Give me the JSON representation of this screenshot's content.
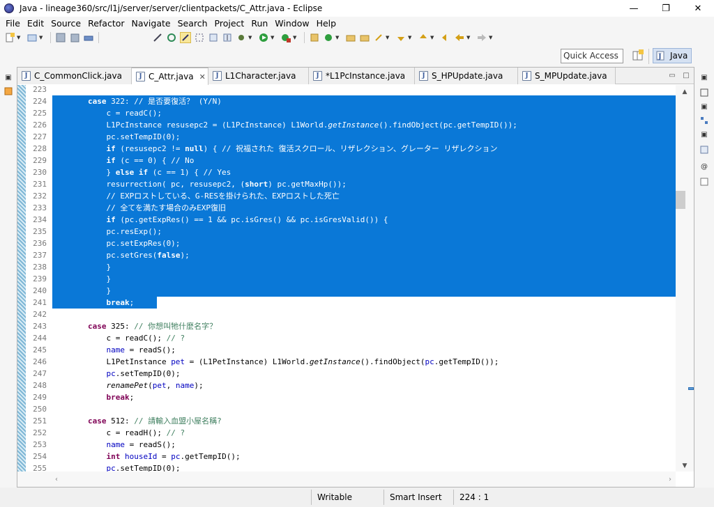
{
  "window": {
    "title": "Java - lineage360/src/l1j/server/server/clientpackets/C_Attr.java - Eclipse",
    "minimize": "—",
    "maximize": "❐",
    "close": "✕"
  },
  "menu": [
    "File",
    "Edit",
    "Source",
    "Refactor",
    "Navigate",
    "Search",
    "Project",
    "Run",
    "Window",
    "Help"
  ],
  "quick_access": {
    "placeholder": "Quick Access"
  },
  "perspective": {
    "label": "Java"
  },
  "tabs": [
    {
      "label": "C_CommonClick.java",
      "active": false
    },
    {
      "label": "C_Attr.java",
      "active": true,
      "close": "✕"
    },
    {
      "label": "L1Character.java",
      "active": false
    },
    {
      "label": "*L1PcInstance.java",
      "active": false
    },
    {
      "label": "S_HPUpdate.java",
      "active": false
    },
    {
      "label": "S_MPUpdate.java",
      "active": false
    }
  ],
  "code_lines": [
    {
      "n": "223",
      "sel": false,
      "html": ""
    },
    {
      "n": "224",
      "sel": true,
      "html": "        <span class=\"kw\">case</span> 322: <span class=\"cm\">// 是否要復活？ (Y/N)</span>"
    },
    {
      "n": "225",
      "sel": true,
      "html": "            c = readC();"
    },
    {
      "n": "226",
      "sel": true,
      "html": "            L1PcInstance resusepc2 = (L1PcInstance) L1World.<span class=\"it\">getInstance</span>().findObject(pc.getTempID());"
    },
    {
      "n": "227",
      "sel": true,
      "html": "            pc.setTempID(0);"
    },
    {
      "n": "228",
      "sel": true,
      "html": "            <span class=\"kw\">if</span> (resusepc2 != <span class=\"kw\">null</span>) { <span class=\"cm\">// 祝福された 復活スクロール、リザレクション、グレーター リザレクション</span>"
    },
    {
      "n": "229",
      "sel": true,
      "html": "            <span class=\"kw\">if</span> (c == 0) { <span class=\"cm\">// No</span>"
    },
    {
      "n": "230",
      "sel": true,
      "html": "            } <span class=\"kw\">else if</span> (c == 1) { <span class=\"cm\">// Yes</span>"
    },
    {
      "n": "231",
      "sel": true,
      "html": "            resurrection( pc, resusepc2, (<span class=\"kw\">short</span>) pc.getMaxHp());"
    },
    {
      "n": "232",
      "sel": true,
      "html": "            <span class=\"cm\">// EXPロストしている、G-RESを掛けられた、EXPロストした死亡</span>"
    },
    {
      "n": "233",
      "sel": true,
      "html": "            <span class=\"cm\">// 全てを満たす場合のみEXP復旧</span>"
    },
    {
      "n": "234",
      "sel": true,
      "html": "            <span class=\"kw\">if</span> (pc.getExpRes() == 1 &amp;&amp; pc.isGres() &amp;&amp; pc.isGresValid()) {"
    },
    {
      "n": "235",
      "sel": true,
      "html": "            pc.resExp();"
    },
    {
      "n": "236",
      "sel": true,
      "html": "            pc.setExpRes(0);"
    },
    {
      "n": "237",
      "sel": true,
      "html": "            pc.setGres(<span class=\"kw\">false</span>);"
    },
    {
      "n": "238",
      "sel": true,
      "html": "            }"
    },
    {
      "n": "239",
      "sel": true,
      "html": "            }"
    },
    {
      "n": "240",
      "sel": true,
      "html": "            }"
    },
    {
      "n": "241",
      "sel": true,
      "html": "            <span class=\"kw\">break</span>;"
    },
    {
      "n": "242",
      "sel": false,
      "html": ""
    },
    {
      "n": "243",
      "sel": false,
      "html": "        <span class=\"kw\">case</span> 325: <span class=\"cm\">// 你想叫牠什麼名字？</span>"
    },
    {
      "n": "244",
      "sel": false,
      "html": "            c = readC(); <span class=\"cm\">// ?</span>"
    },
    {
      "n": "245",
      "sel": false,
      "html": "            <span class=\"fld\">name</span> = readS();"
    },
    {
      "n": "246",
      "sel": false,
      "html": "            L1PetInstance <span class=\"fld\">pet</span> = (L1PetInstance) L1World.<span class=\"it\">getInstance</span>().findObject(<span class=\"fld\">pc</span>.getTempID());"
    },
    {
      "n": "247",
      "sel": false,
      "html": "            <span class=\"fld\">pc</span>.setTempID(0);"
    },
    {
      "n": "248",
      "sel": false,
      "html": "            <span class=\"it\">renamePet</span>(<span class=\"fld\">pet</span>, <span class=\"fld\">name</span>);"
    },
    {
      "n": "249",
      "sel": false,
      "html": "            <span class=\"kw\">break</span>;"
    },
    {
      "n": "250",
      "sel": false,
      "html": ""
    },
    {
      "n": "251",
      "sel": false,
      "html": "        <span class=\"kw\">case</span> 512: <span class=\"cm\">// 請輸入血盟小屋名稱?</span>"
    },
    {
      "n": "252",
      "sel": false,
      "html": "            c = readH(); <span class=\"cm\">// ?</span>"
    },
    {
      "n": "253",
      "sel": false,
      "html": "            <span class=\"fld\">name</span> = readS();"
    },
    {
      "n": "254",
      "sel": false,
      "html": "            <span class=\"kw\">int</span> <span class=\"fld\">houseId</span> = <span class=\"fld\">pc</span>.getTempID();"
    },
    {
      "n": "255",
      "sel": false,
      "html": "            <span class=\"fld\">pc</span>.setTempID(0);"
    }
  ],
  "status": {
    "writable": "Writable",
    "insert_mode": "Smart Insert",
    "position": "224 : 1"
  },
  "colors": {
    "selection": "#0a78d7",
    "keyword": "#7f0055",
    "comment": "#3f7f5f",
    "field": "#0000c0"
  }
}
